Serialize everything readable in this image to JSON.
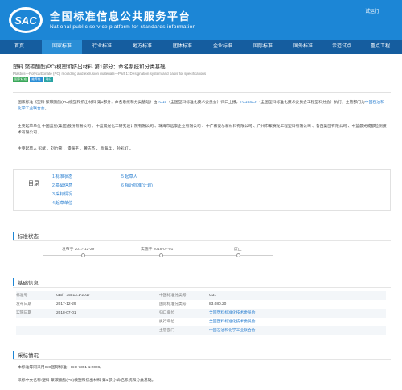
{
  "header": {
    "logo_text": "SAC",
    "title": "全国标准信息公共服务平台",
    "subtitle": "National public service platform  for standards information",
    "trial": "试运行"
  },
  "nav": [
    {
      "label": "首页",
      "active": false
    },
    {
      "label": "国家标准",
      "active": true
    },
    {
      "label": "行业标准",
      "active": false
    },
    {
      "label": "地方标准",
      "active": false
    },
    {
      "label": "团体标准",
      "active": false
    },
    {
      "label": "企业标准",
      "active": false
    },
    {
      "label": "国际标准",
      "active": false
    },
    {
      "label": "国外标准",
      "active": false
    },
    {
      "label": "示范试点",
      "active": false
    },
    {
      "label": "重点工程",
      "active": false
    }
  ],
  "standard": {
    "title": "塑料 聚碳酸酯(PC)模塑和挤出材料 第1部分：命名系统和分类基础",
    "title_en": "Plastics—Polycarbonate (PC) moulding and extrusion materials—Part 1: Designation system and basis for specifications",
    "tags": [
      {
        "label": "国家标准",
        "color": "#3aa85a"
      },
      {
        "label": "推荐性",
        "color": "#2a8ed6"
      },
      {
        "label": "现行",
        "color": "#29a3a3"
      }
    ]
  },
  "intro": {
    "p1_a": "国家标准《塑料 聚碳酸酯(PC)模塑和挤出材料 第1部分：命名系统和分类基础》由",
    "p1_tc": "TC15",
    "p1_b": "（全国塑料标准化技术委员会）归口上报，",
    "p1_sc": "TC15SC9",
    "p1_c": "（全国塑料标准化技术委员会工程塑料分会）执行，主管部门为",
    "p1_dept": "中国石油和化学工业联合会",
    "p1_d": "。",
    "p2": "主要起草单位 中国蓝星(集团)股份有限公司 、中蓝晨光化工研究设计院有限公司 、珠海市远康企业有限公司 、中广核俊尔新材料有限公司 、广州市聚赛龙工程塑料有限公司 、鲁西集团有限公司 、中蓝晨光成都检测技术有限公司 。",
    "p3": "主要起草人 彭斌 、刘力荣 、谭振平 、黄志杰 、袁海兵 、孙彩虹 。"
  },
  "toc": {
    "label": "目录",
    "items": [
      "1 标准状态",
      "2 基础信息",
      "3 采标情况",
      "4 起草单位",
      "5 起草人",
      "6 相近标准(计划)"
    ]
  },
  "status": {
    "title": "标准状态",
    "publish": "发布于 2017-12-29",
    "implement": "实施于 2018-07-01",
    "abolish": "废止"
  },
  "basic": {
    "title": "基础信息",
    "rows": [
      {
        "k1": "标准号",
        "v1": "GB/T 35513.1-2017",
        "k2": "中国标准分类号",
        "v2": "G31",
        "v2_link": false
      },
      {
        "k1": "发布日期",
        "v1": "2017-12-29",
        "k2": "国际标准分类号",
        "v2": "83.080.20",
        "v2_link": false
      },
      {
        "k1": "实施日期",
        "v1": "2018-07-01",
        "k2": "归口单位",
        "v2": "全国塑料标准化技术委员会",
        "v2_link": true
      },
      {
        "k1": "",
        "v1": "",
        "k2": "执行单位",
        "v2": "全国塑料标准化技术委员会",
        "v2_link": true
      },
      {
        "k1": "",
        "v1": "",
        "k2": "主管部门",
        "v2": "中国石油和化学工业联合会",
        "v2_link": true
      }
    ]
  },
  "adoption": {
    "title": "采标情况",
    "line1": "本标准等同采用ISO国际标准：ISO 7391-1:2006。",
    "line2": "采标中文名称:塑料 聚碳酸酯(PC)模塑和挤出材料 第1部分:命名系统和分类基础。"
  }
}
